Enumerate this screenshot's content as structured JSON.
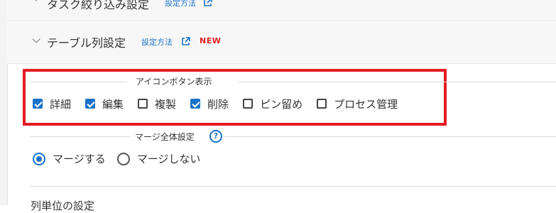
{
  "sections": {
    "task_filter": {
      "title": "タスク絞り込み設定",
      "help_link": "設定方法",
      "external_icon": "external-link-icon",
      "chevron_icon": "chevron-right-icon"
    },
    "table_columns": {
      "title": "テーブル列設定",
      "help_link": "設定方法",
      "external_icon": "external-link-icon",
      "chevron_icon": "chevron-down-icon",
      "badge": "NEW"
    }
  },
  "icon_button_group": {
    "legend": "アイコンボタン表示",
    "highlight_color": "#e31b23",
    "checkboxes": [
      {
        "label": "詳細",
        "checked": true
      },
      {
        "label": "編集",
        "checked": true
      },
      {
        "label": "複製",
        "checked": false
      },
      {
        "label": "削除",
        "checked": true
      },
      {
        "label": "ピン留め",
        "checked": false
      },
      {
        "label": "プロセス管理",
        "checked": false
      }
    ]
  },
  "merge_group": {
    "legend": "マージ全体設定",
    "help_icon": "question-circle-icon",
    "help_icon_glyph": "?",
    "options": [
      {
        "label": "マージする",
        "selected": true
      },
      {
        "label": "マージしない",
        "selected": false
      }
    ]
  },
  "next_section_label": "列単位の設定",
  "colors": {
    "accent": "#1a73c8",
    "new_badge": "#e02020"
  }
}
